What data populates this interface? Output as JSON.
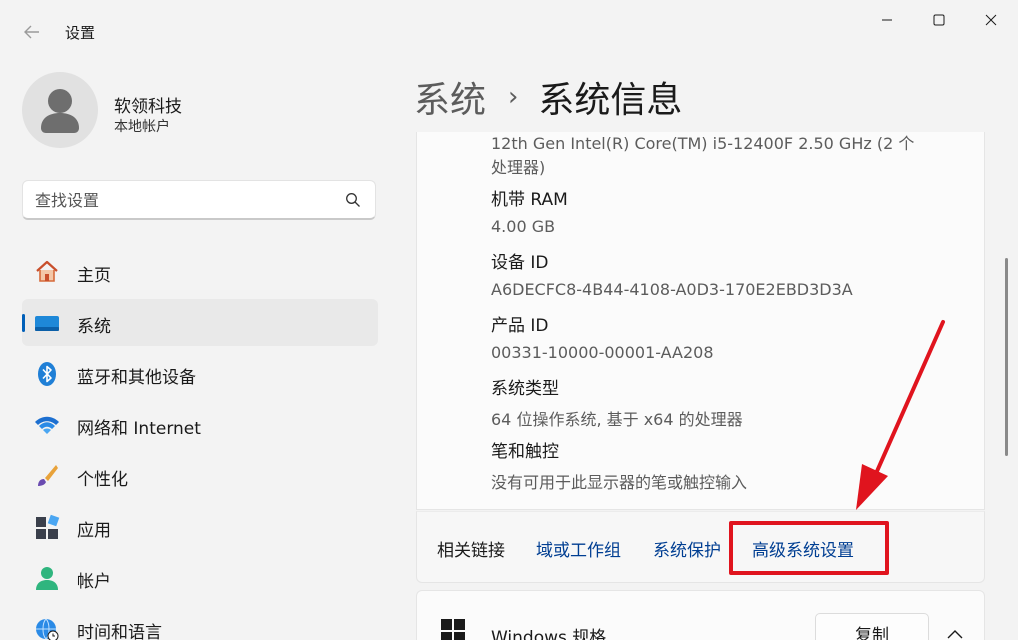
{
  "window": {
    "title": "设置",
    "back_icon": "arrow-left-icon",
    "min_icon": "minimize-icon",
    "max_icon": "maximize-icon",
    "close_icon": "close-icon"
  },
  "profile": {
    "name": "软领科技",
    "account_type": "本地帐户"
  },
  "search": {
    "placeholder": "查找设置"
  },
  "nav": {
    "items": [
      {
        "label": "主页",
        "icon": "home-icon"
      },
      {
        "label": "系统",
        "icon": "system-display-icon",
        "active": true
      },
      {
        "label": "蓝牙和其他设备",
        "icon": "bluetooth-icon"
      },
      {
        "label": "网络和 Internet",
        "icon": "wifi-icon"
      },
      {
        "label": "个性化",
        "icon": "brush-icon"
      },
      {
        "label": "应用",
        "icon": "apps-icon"
      },
      {
        "label": "帐户",
        "icon": "account-icon"
      },
      {
        "label": "时间和语言",
        "icon": "globe-clock-icon"
      }
    ]
  },
  "breadcrumb": {
    "parent": "系统",
    "separator": "›",
    "current": "系统信息"
  },
  "specs": {
    "processor_value_line1": "12th Gen Intel(R) Core(TM) i5-12400F   2.50 GHz  (2 个",
    "processor_value_line2": "处理器)",
    "ram_label": "机带 RAM",
    "ram_value": "4.00 GB",
    "device_id_label": "设备 ID",
    "device_id_value": "A6DECFC8-4B44-4108-A0D3-170E2EBD3D3A",
    "product_id_label": "产品 ID",
    "product_id_value": "00331-10000-00001-AA208",
    "system_type_label": "系统类型",
    "system_type_value": "64 位操作系统, 基于 x64 的处理器",
    "pen_touch_label": "笔和触控",
    "pen_touch_value": "没有可用于此显示器的笔或触控输入"
  },
  "related_links": {
    "label": "相关链接",
    "domain": "域或工作组",
    "protection": "系统保护",
    "advanced": "高级系统设置"
  },
  "windows_spec": {
    "title": "Windows 规格",
    "copy_label": "复制"
  },
  "colors": {
    "accent": "#005fb8",
    "link": "#003e92",
    "annotation_red": "#e0141e"
  }
}
